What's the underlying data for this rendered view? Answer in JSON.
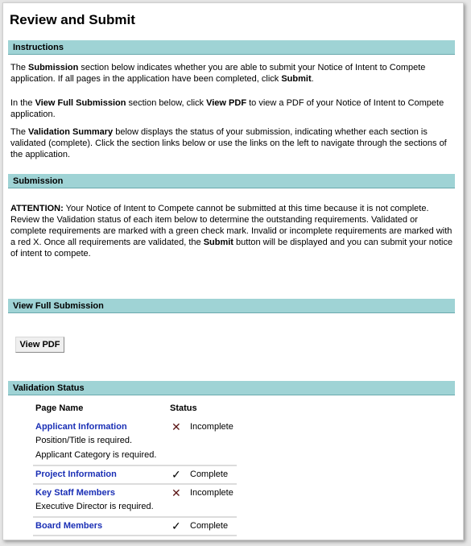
{
  "title": "Review and Submit",
  "instructions": {
    "header": "Instructions",
    "p1": {
      "a": "The ",
      "b1": "Submission",
      "c": " section below indicates whether you are able to submit your Notice of Intent to Compete application. If all pages in the application have been completed, click ",
      "b2": "Submit",
      "d": "."
    },
    "p2": {
      "a": "In the ",
      "b1": "View Full Submission",
      "c": " section below, click ",
      "b2": "View PDF",
      "d": " to view a PDF of your Notice of Intent to Compete application."
    },
    "p3": {
      "a": "The ",
      "b1": "Validation Summary",
      "c": " below displays the status of your submission, indicating whether each section is validated (complete). Click the section links below or use the links on the left to navigate through the sections of the application."
    }
  },
  "submission": {
    "header": "Submission",
    "attention_label": "ATTENTION:",
    "text_a": " Your Notice of Intent to Compete cannot be submitted at this time because it is not complete. Review the Validation status of each item below to determine the outstanding requirements. Validated or complete requirements are marked with a green check mark. Invalid or incomplete requirements are marked with a red X. Once all requirements are validated, the ",
    "submit_word": "Submit",
    "text_b": " button will be displayed and you can submit your notice of intent to compete."
  },
  "view_full": {
    "header": "View Full Submission",
    "button_label": "View PDF"
  },
  "validation": {
    "header": "Validation Status",
    "col_page": "Page Name",
    "col_status": "Status",
    "rows": [
      {
        "page": "Applicant Information",
        "icon": "✕",
        "icon_name": "x-icon",
        "icon_color": "#5a1414",
        "status": "Incomplete",
        "errors": [
          "Position/Title is required.",
          "Applicant Category is required."
        ]
      },
      {
        "page": "Project Information",
        "icon": "✓",
        "icon_name": "check-icon",
        "icon_color": "#000000",
        "status": "Complete",
        "errors": []
      },
      {
        "page": "Key Staff Members",
        "icon": "✕",
        "icon_name": "x-icon",
        "icon_color": "#5a1414",
        "status": "Incomplete",
        "errors": [
          "Executive Director is required."
        ]
      },
      {
        "page": "Board Members",
        "icon": "✓",
        "icon_name": "check-icon",
        "icon_color": "#000000",
        "status": "Complete",
        "errors": []
      }
    ]
  }
}
